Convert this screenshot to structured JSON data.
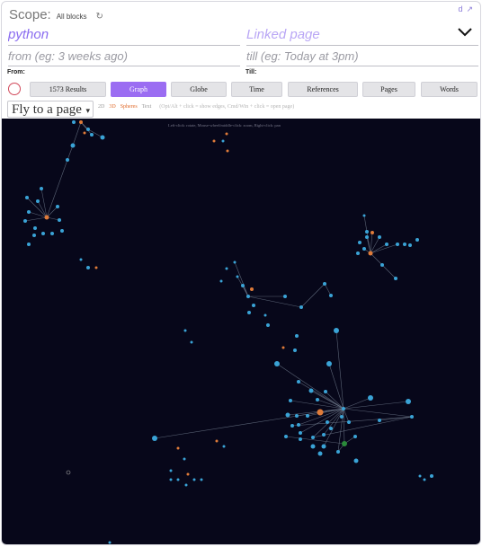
{
  "scope": {
    "label": "Scope:",
    "value": "All blocks",
    "refresh_icon": "refresh-icon"
  },
  "corner_icons": [
    "d",
    "↗"
  ],
  "filters": {
    "search_value": "python",
    "linked_placeholder": "Linked page",
    "from_placeholder": "from (eg: 3 weeks ago)",
    "till_placeholder": "till (eg: Today at 3pm)",
    "from_label": "From:",
    "till_label": "Till:"
  },
  "toolbar": {
    "results_label": "1573 Results",
    "tabs": [
      {
        "label": "Graph",
        "active": true
      },
      {
        "label": "Globe",
        "active": false
      },
      {
        "label": "Time",
        "active": false
      },
      {
        "label": "References",
        "active": false
      },
      {
        "label": "Pages",
        "active": false
      },
      {
        "label": "Words",
        "active": false
      }
    ]
  },
  "view": {
    "fly_to_label": "Fly to a page",
    "mode_2d": "2D",
    "mode_3d": "3D",
    "mode_spheres": "Spheres",
    "mode_text": "Text",
    "hint": "(Opt/Alt + click = show edges, Cmd/Win + click = open page)"
  },
  "graph": {
    "hint": "Left-click: rotate, Mouse-wheel/middle-click: zoom, Right-click: pan",
    "colors": {
      "background": "#07071a",
      "node": "#3aa3d6",
      "hub": "#e07b39",
      "highlight": "#2a8a3a",
      "edge": "#6f7a8c"
    }
  }
}
